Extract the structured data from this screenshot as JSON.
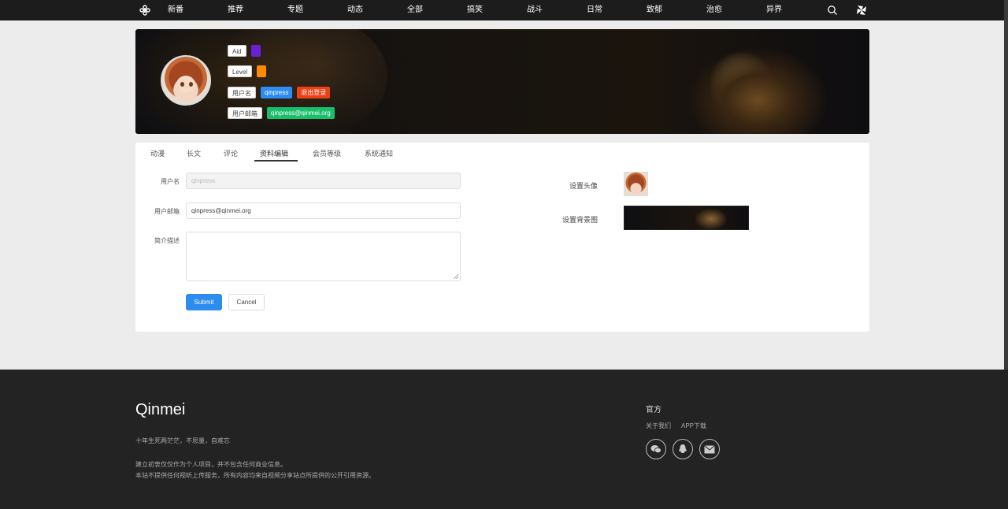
{
  "nav": {
    "items": [
      "新番",
      "推荐",
      "专题",
      "动态",
      "全部",
      "搞笑",
      "战斗",
      "日常",
      "致郁",
      "治愈",
      "异界"
    ],
    "icons": {
      "logo": "flower-icon",
      "search": "search-icon",
      "menu": "pinwheel-icon"
    }
  },
  "profile": {
    "aid_label": "Aid",
    "aid_color": "#6c1fd6",
    "level_label": "Level",
    "level_color": "#ff8a00",
    "username_label": "用户名",
    "username": "qinpress",
    "logout": "退出登录",
    "email_label": "用户邮箱",
    "email": "qinpress@qinmei.org"
  },
  "tabs": [
    "动漫",
    "长文",
    "评论",
    "资料编辑",
    "会员等级",
    "系统通知"
  ],
  "active_tab": "资料编辑",
  "form": {
    "username_label": "用户名",
    "username_value": "qinpress",
    "email_label": "用户邮箱",
    "email_value": "qinpress@qinmei.org",
    "bio_label": "简介描述",
    "bio_value": "",
    "submit": "Submit",
    "cancel": "Cancel"
  },
  "settings": {
    "avatar_label": "设置头像",
    "background_label": "设置背景图"
  },
  "footer": {
    "brand": "Qinmei",
    "motto": "十年生死两茫茫，不思量，自难忘",
    "disclaimer_1": "建立初衷仅仅作为个人项目，并不包含任何商业信息。",
    "disclaimer_2": "本站不提供任何视听上传服务，所有内容均来自视频分享站点所提供的公开引用资源。",
    "col_title": "官方",
    "links": [
      "关于我们",
      "APP下载"
    ],
    "social_icons": [
      "wechat-icon",
      "qq-icon",
      "mail-icon"
    ]
  }
}
